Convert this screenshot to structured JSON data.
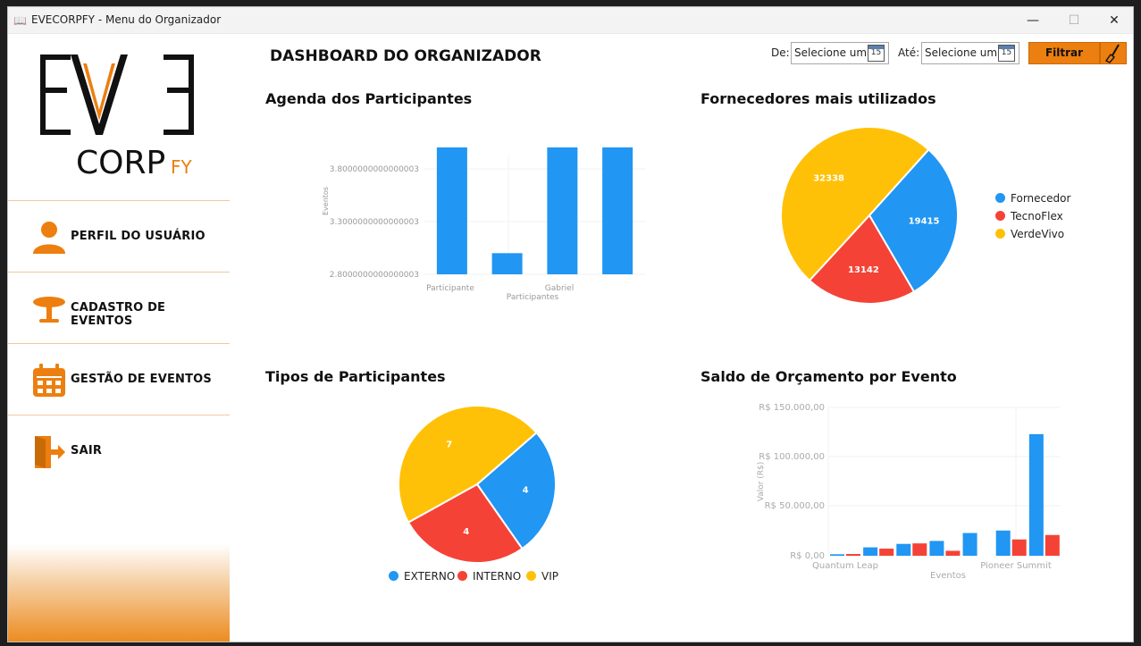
{
  "window": {
    "title": "EVECORPFY - Menu do Organizador",
    "min_icon": "minimize-icon",
    "max_icon": "maximize-icon",
    "close_icon": "close-icon"
  },
  "logo": {
    "text_top": "EVE",
    "text_mid": "CORP",
    "text_sub": "FY"
  },
  "sidebar": {
    "items": [
      {
        "label": "PERFIL DO USUÁRIO",
        "icon": "user-icon"
      },
      {
        "label": "CADASTRO DE EVENTOS",
        "icon": "table-icon"
      },
      {
        "label": "GESTÃO DE EVENTOS",
        "icon": "calendar-icon"
      },
      {
        "label": "SAIR",
        "icon": "exit-door-icon"
      }
    ]
  },
  "header": {
    "title": "DASHBOARD DO ORGANIZADOR",
    "from_label": "De:",
    "to_label": "Até:",
    "from_value": "Selecione uma",
    "to_value": "Selecione uma",
    "calendar_day": "15",
    "filter_label": "Filtrar",
    "clear_icon": "broom-icon"
  },
  "colors": {
    "accent": "#ec7f10",
    "blue": "#2196f3",
    "red": "#f44336",
    "yellow": "#ffc107"
  },
  "chart_data": [
    {
      "type": "bar",
      "title": "Agenda dos Participantes",
      "xlabel": "Participantes",
      "ylabel": "Eventos",
      "tick_labels_x": [
        "Participante",
        "Gabriel"
      ],
      "tick_labels_y": [
        "3.8000000000000003",
        "3.3000000000000003",
        "2.8000000000000003"
      ],
      "values": [
        4,
        3,
        4,
        4
      ],
      "ylim": [
        2.8,
        4
      ]
    },
    {
      "type": "pie",
      "title": "Fornecedores mais utilizados",
      "legend": [
        "Fornecedor",
        "TecnoFlex",
        "VerdeVivo"
      ],
      "values": [
        19415,
        13142,
        32338
      ],
      "labels": [
        "19415",
        "13142",
        "32338"
      ],
      "legend_position": "right"
    },
    {
      "type": "pie",
      "title": "Tipos de Participantes",
      "legend": [
        "EXTERNO",
        "INTERNO",
        "VIP"
      ],
      "values": [
        4,
        4,
        7
      ],
      "labels": [
        "4",
        "4",
        "7"
      ],
      "legend_position": "bottom"
    },
    {
      "type": "bar",
      "title": "Saldo de Orçamento por Evento",
      "xlabel": "Eventos",
      "ylabel": "Valor (R$)",
      "tick_labels_x": [
        "Quantum Leap",
        "Pioneer Summit"
      ],
      "tick_labels_y": [
        "R$ 150.000,00",
        "R$ 100.000,00",
        "R$ 50.000,00",
        "R$ 0,00"
      ],
      "ylim": [
        0,
        150000
      ],
      "series": [
        {
          "values": [
            1500,
            8500,
            12000,
            15000,
            23000,
            25500,
            123000
          ]
        },
        {
          "values": [
            1800,
            7200,
            12500,
            5000,
            0,
            16500,
            21000
          ]
        }
      ]
    }
  ]
}
